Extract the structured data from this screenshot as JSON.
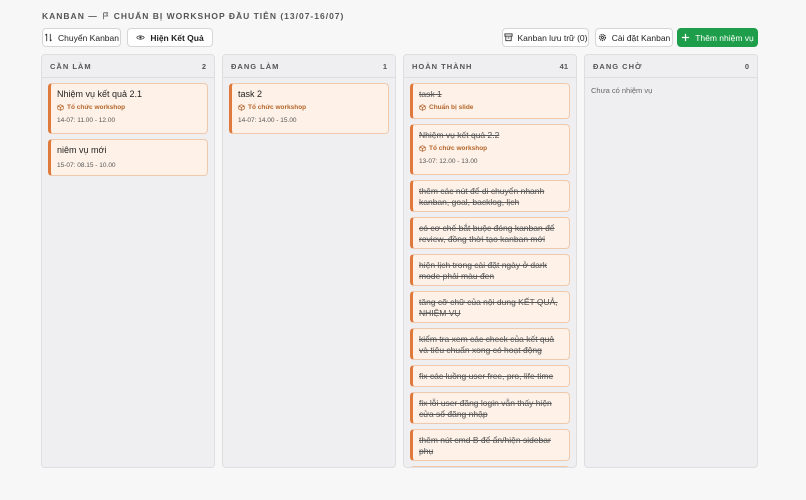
{
  "breadcrumb": {
    "root": "KANBAN —",
    "workshop": "CHUẨN BỊ WORKSHOP ĐẦU TIÊN (13/07-16/07)"
  },
  "toolbar": {
    "switch_kanban": "Chuyển Kanban",
    "show_results": "Hiện Kết Quả",
    "archive": "Kanban lưu trữ (0)",
    "settings": "Cài đặt Kanban",
    "add_task": "Thêm nhiệm vụ"
  },
  "columns": [
    {
      "title": "CẦN LÀM",
      "count": "2",
      "cards": [
        {
          "title": "Nhiệm vụ kết quả 2.1",
          "tag": "Tổ chức workshop",
          "time": "14-07: 11.00 - 12.00"
        },
        {
          "title": "niêm vụ mới",
          "time": "15-07: 08.15 - 10.00"
        }
      ]
    },
    {
      "title": "ĐANG LÀM",
      "count": "1",
      "cards": [
        {
          "title": "task 2",
          "tag": "Tổ chức workshop",
          "time": "14-07: 14.00 - 15.00"
        }
      ]
    },
    {
      "title": "HOÀN THÀNH",
      "count": "41",
      "cards": [
        {
          "title": "task 1",
          "tag": "Chuẩn bị slide"
        },
        {
          "title": "Nhiệm vụ kết quả 2.2",
          "tag": "Tổ chức workshop",
          "time": "13-07: 12.00 - 13.00"
        },
        {
          "title": "thêm các nút để di chuyển nhanh kanban, goal, backlog, lịch"
        },
        {
          "title": "có cơ chế bắt buộc đóng kanban để review, đồng thời tạo kanban mới"
        },
        {
          "title": "hiện lịch trong cài đặt ngày ở dark mode phải màu đen"
        },
        {
          "title": "tăng cỡ chữ của nội dung KẾT QUẢ, NHIỆM VỤ"
        },
        {
          "title": "kiểm tra xem các check của kết quả và tiêu chuẩn xong có hoạt động"
        },
        {
          "title": "fix các luồng user free, pro, life time"
        },
        {
          "title": "fix lỗi user đăng login vẫn thấy hiện cửa sổ đăng nhập"
        },
        {
          "title": "thêm nút cmd B để ẩn/hiện sidebar phụ"
        }
      ]
    },
    {
      "title": "ĐANG CHỜ",
      "count": "0",
      "empty": "Chưa có nhiệm vụ",
      "cards": []
    }
  ],
  "colors": {
    "accent": "#1e9e4a",
    "card_border": "#e07a3c",
    "card_bg": "#fdf1e8",
    "tag": "#b5652a"
  }
}
